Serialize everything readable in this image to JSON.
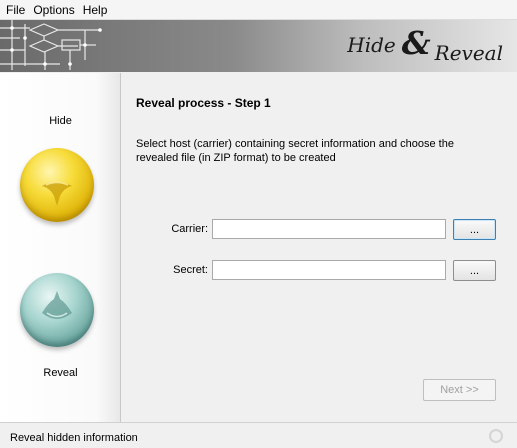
{
  "menu": {
    "file": "File",
    "options": "Options",
    "help": "Help"
  },
  "banner": {
    "title_word1": "Hide",
    "title_amp": "&",
    "title_word2": "Reveal"
  },
  "sidebar": {
    "hide_label": "Hide",
    "reveal_label": "Reveal"
  },
  "main": {
    "step_title": "Reveal process - Step 1",
    "instructions": "Select host (carrier) containing secret information and choose the revealed file (in ZIP format) to be created",
    "carrier": {
      "label": "Carrier:",
      "value": "",
      "browse_label": "..."
    },
    "secret": {
      "label": "Secret:",
      "value": "",
      "browse_label": "..."
    },
    "next_label": "Next >>",
    "next_enabled": false
  },
  "status": {
    "text": "Reveal hidden information"
  },
  "icons": {
    "hide": "hide-orb-icon",
    "reveal": "reveal-orb-icon",
    "busy": "busy-indicator-icon"
  },
  "colors": {
    "hide_orb": "#f2d23a",
    "reveal_orb": "#8cc2bc",
    "banner_dark": "#6a6a6a"
  }
}
